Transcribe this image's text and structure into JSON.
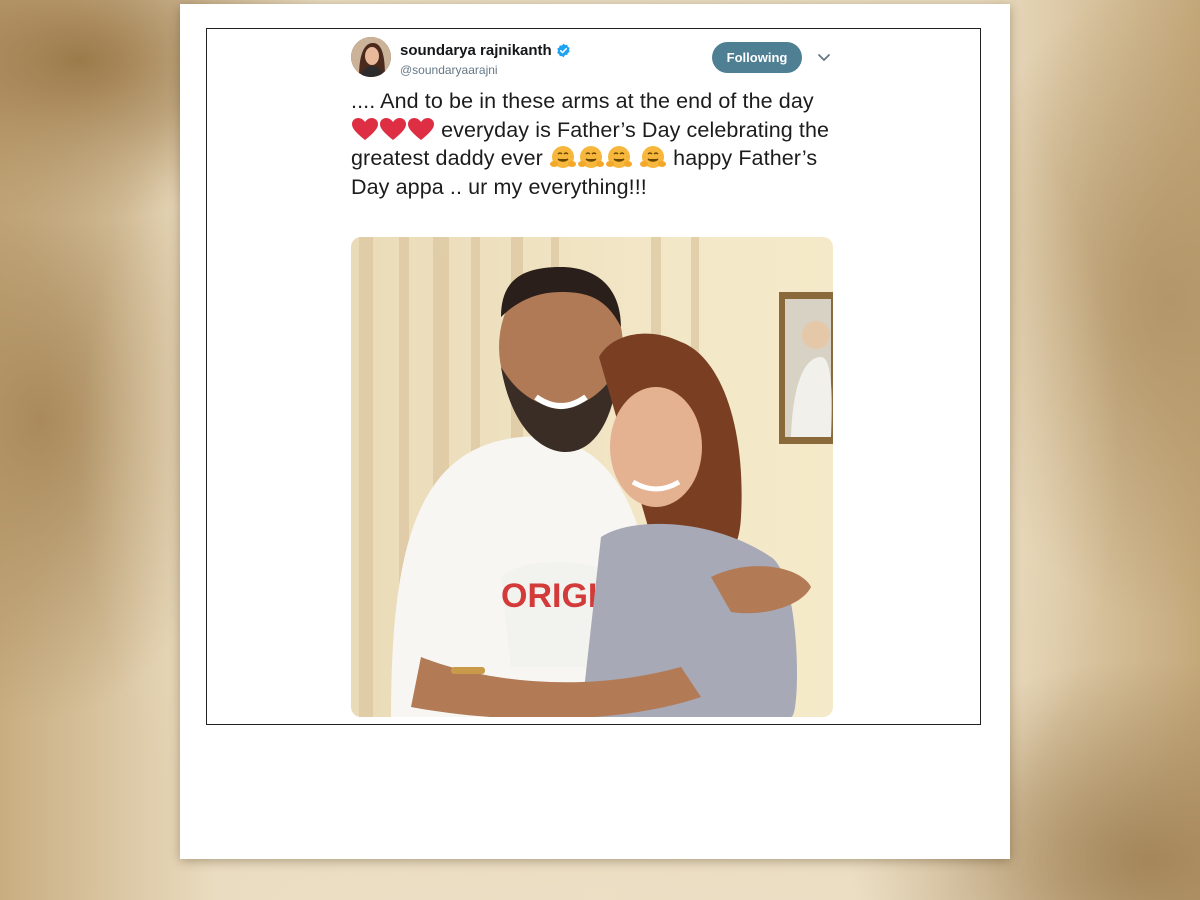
{
  "tweet": {
    "display_name": "soundarya rajnikanth",
    "handle": "@soundaryaarajni",
    "follow_label": "Following",
    "text": {
      "segment1": ".... And to be in these arms at the end of the day",
      "segment2": "everyday is Father’s Day celebrating the greatest daddy ever",
      "segment3": "happy Father’s Day appa .. ur my everything!!!"
    },
    "emojis": {
      "group1": [
        "red-heart",
        "red-heart",
        "red-heart"
      ],
      "group2": [
        "hugging-face",
        "hugging-face",
        "hugging-face",
        "hugging-face"
      ]
    },
    "colors": {
      "follow_button": "#4e7f93",
      "verified_badge": "#1da1f2",
      "heart": "#dd2e44",
      "hug_face": "#f6b73c"
    }
  }
}
